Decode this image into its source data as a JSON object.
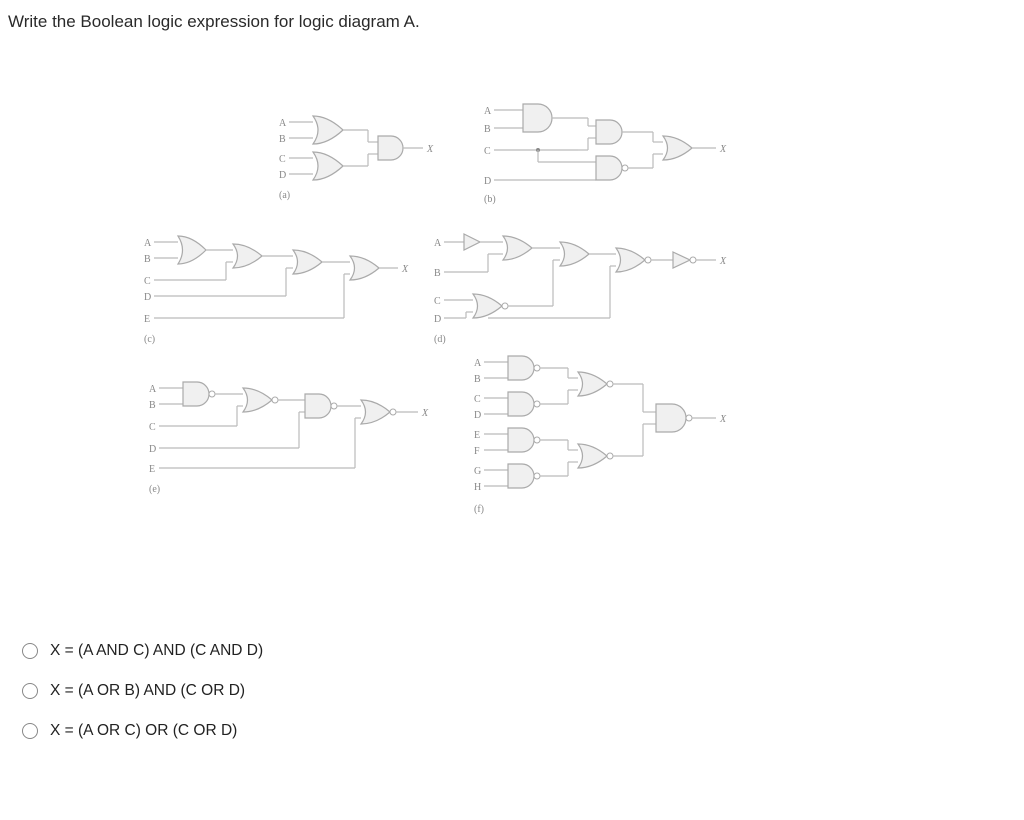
{
  "question": "Write the Boolean logic expression for logic diagram A.",
  "diagrams": {
    "a": {
      "caption": "(a)",
      "inputs": [
        "A",
        "B",
        "C",
        "D"
      ],
      "output": "X"
    },
    "b": {
      "caption": "(b)",
      "inputs": [
        "A",
        "B",
        "C",
        "D"
      ],
      "output": "X"
    },
    "c": {
      "caption": "(c)",
      "inputs": [
        "A",
        "B",
        "C",
        "D",
        "E"
      ],
      "output": "X"
    },
    "d": {
      "caption": "(d)",
      "inputs": [
        "A",
        "B",
        "C",
        "D"
      ],
      "output": "X"
    },
    "e": {
      "caption": "(e)",
      "inputs": [
        "A",
        "B",
        "C",
        "D",
        "E"
      ],
      "output": "X"
    },
    "f": {
      "caption": "(f)",
      "inputs": [
        "A",
        "B",
        "C",
        "D",
        "E",
        "F",
        "G",
        "H"
      ],
      "output": "X"
    }
  },
  "options": {
    "opt1": "X = (A AND C) AND (C AND D)",
    "opt2": "X = (A OR B) AND (C OR D)",
    "opt3": "X = (A OR C) OR (C OR D)"
  }
}
